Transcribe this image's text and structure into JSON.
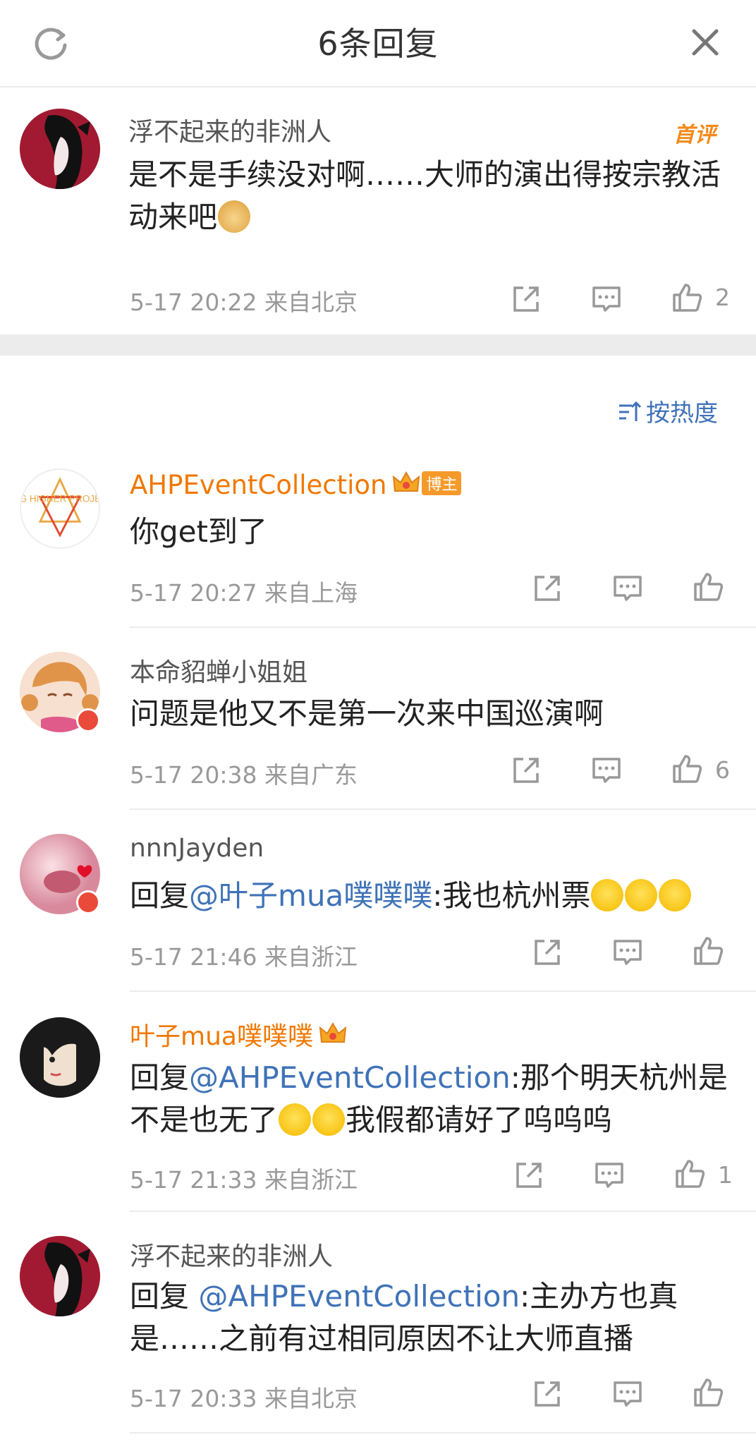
{
  "header": {
    "title": "6条回复"
  },
  "root": {
    "username": "浮不起来的非洲人",
    "badge": "首评",
    "text": "是不是手续没对啊……大师的演出得按宗教活动来吧",
    "time": "5-17 20:22",
    "location": "来自北京",
    "likes": "2"
  },
  "sort": {
    "label": "按热度"
  },
  "replies": [
    {
      "username": "AHPEventCollection",
      "tag": "博主",
      "text": "你get到了",
      "time": "5-17 20:27",
      "location": "来自上海",
      "likes": ""
    },
    {
      "username": "本命貂蝉小姐姐",
      "text": "问题是他又不是第一次来中国巡演啊",
      "time": "5-17 20:38",
      "location": "来自广东",
      "likes": "6"
    },
    {
      "username": "nnnJayden",
      "prefix": "回复",
      "mention": "@叶子mua噗噗噗",
      "text": ":我也杭州票",
      "time": "5-17 21:46",
      "location": "来自浙江",
      "likes": ""
    },
    {
      "username": "叶子mua噗噗噗",
      "prefix": "回复",
      "mention": "@AHPEventCollection",
      "text": ":那个明天杭州是不是也无了",
      "text2": "我假都请好了呜呜呜",
      "time": "5-17 21:33",
      "location": "来自浙江",
      "likes": "1"
    },
    {
      "username": "浮不起来的非洲人",
      "prefix": "回复 ",
      "mention": "@AHPEventCollection",
      "text": ":主办方也真是……之前有过相同原因不让大师直播",
      "time": "5-17 20:33",
      "location": "来自北京",
      "likes": ""
    }
  ],
  "logo_text": "ACG HIGHER PROJECT",
  "colors": {
    "accent_blue": "#3f72b8",
    "orange_name": "#f07800",
    "meta_gray": "#999999"
  },
  "icons": [
    "refresh-icon",
    "close-icon",
    "share-icon",
    "comment-icon",
    "like-icon",
    "sort-icon",
    "crown-icon"
  ]
}
